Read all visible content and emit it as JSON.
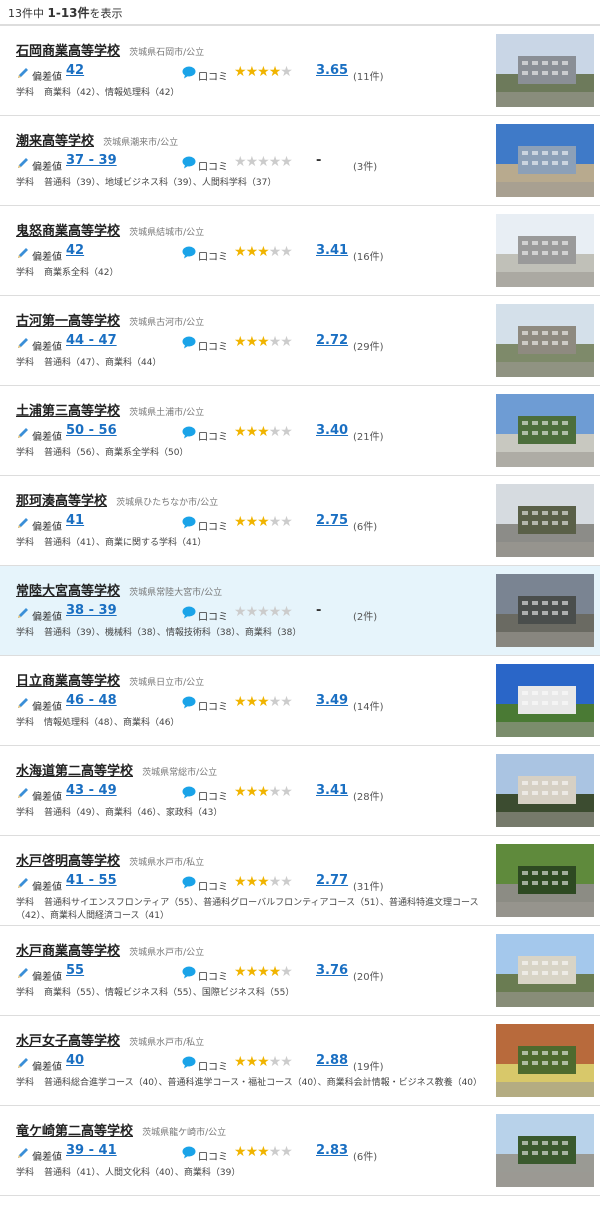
{
  "summary": {
    "prefix": "13件中",
    "range": "1-13件",
    "suffix": "を表示"
  },
  "labels": {
    "hensachi": "偏差値",
    "review": "口コミ",
    "dept": "学科"
  },
  "schools": [
    {
      "name": "石岡商業高等学校",
      "location": "茨城県石岡市/公立",
      "hensachi": "42",
      "stars": 4,
      "score": "3.65",
      "count": "(11件)",
      "departments": "商業科（42）、情報処理科（42）",
      "photo": [
        "#c9d6e6",
        "#8a8f96",
        "#6d7a5b"
      ]
    },
    {
      "name": "潮来高等学校",
      "location": "茨城県潮来市/公立",
      "hensachi": "37 - 39",
      "stars": 0,
      "score": "-",
      "count": "(3件)",
      "departments": "普通科（39）、地域ビジネス科（39）、人間科学科（37）",
      "photo": [
        "#3f7ac8",
        "#8ca0b8",
        "#b8aa8e"
      ]
    },
    {
      "name": "鬼怒商業高等学校",
      "location": "茨城県結城市/公立",
      "hensachi": "42",
      "stars": 3,
      "score": "3.41",
      "count": "(16件)",
      "departments": "商業系全科（42）",
      "photo": [
        "#e8eef4",
        "#9a9a9a",
        "#c0c0b8"
      ]
    },
    {
      "name": "古河第一高等学校",
      "location": "茨城県古河市/公立",
      "hensachi": "44 - 47",
      "stars": 3,
      "score": "2.72",
      "count": "(29件)",
      "departments": "普通科（47）、商業科（44）",
      "photo": [
        "#d4e0ea",
        "#8e8a80",
        "#7e8a6a"
      ]
    },
    {
      "name": "土浦第三高等学校",
      "location": "茨城県土浦市/公立",
      "hensachi": "50 - 56",
      "stars": 3,
      "score": "3.40",
      "count": "(21件)",
      "departments": "普通科（56）、商業系全学科（50）",
      "photo": [
        "#6e9cd4",
        "#4c6e3c",
        "#c8c8c0"
      ]
    },
    {
      "name": "那珂湊高等学校",
      "location": "茨城県ひたちなか市/公立",
      "hensachi": "41",
      "stars": 3,
      "score": "2.75",
      "count": "(6件)",
      "departments": "普通科（41）、商業に関する学科（41）",
      "photo": [
        "#d6dbe0",
        "#5a6048",
        "#8c8c88"
      ]
    },
    {
      "name": "常陸大宮高等学校",
      "location": "茨城県常陸大宮市/公立",
      "hensachi": "38 - 39",
      "stars": 0,
      "score": "-",
      "count": "(2件)",
      "departments": "普通科（39）、機械科（38）、情報技術科（38）、商業科（38）",
      "photo": [
        "#7a8492",
        "#4a4e4c",
        "#6a6a62"
      ]
    },
    {
      "name": "日立商業高等学校",
      "location": "茨城県日立市/公立",
      "hensachi": "46 - 48",
      "stars": 3,
      "score": "3.49",
      "count": "(14件)",
      "departments": "情報処理科（48）、商業科（46）",
      "photo": [
        "#2a66c8",
        "#e8e8e8",
        "#4a7a34"
      ]
    },
    {
      "name": "水海道第二高等学校",
      "location": "茨城県常総市/公立",
      "hensachi": "43 - 49",
      "stars": 3,
      "score": "3.41",
      "count": "(28件)",
      "departments": "普通科（49）、商業科（46）、家政科（43）",
      "photo": [
        "#aac4e2",
        "#d6d0c4",
        "#3c4c30"
      ]
    },
    {
      "name": "水戸啓明高等学校",
      "location": "茨城県水戸市/私立",
      "hensachi": "41 - 55",
      "stars": 3,
      "score": "2.77",
      "count": "(31件)",
      "departments": "普通科サイエンスフロンティア（55）、普通科グローバルフロンティアコース（51）、普通科特進文理コース（42）、商業科人間経済コース（41）",
      "photo": [
        "#5f8a3c",
        "#2e4a22",
        "#8c8c84"
      ]
    },
    {
      "name": "水戸商業高等学校",
      "location": "茨城県水戸市/公立",
      "hensachi": "55",
      "stars": 4,
      "score": "3.76",
      "count": "(20件)",
      "departments": "商業科（55）、情報ビジネス科（55）、国際ビジネス科（55）",
      "photo": [
        "#a4c8ec",
        "#d8d4c6",
        "#6a7c52"
      ]
    },
    {
      "name": "水戸女子高等学校",
      "location": "茨城県水戸市/私立",
      "hensachi": "40",
      "stars": 3,
      "score": "2.88",
      "count": "(19件)",
      "departments": "普通科総合進学コース（40）、普通科進学コース・福祉コース（40）、商業科会計情報・ビジネス教養（40）",
      "photo": [
        "#b86a3c",
        "#4e6a2e",
        "#d8c86a"
      ]
    },
    {
      "name": "竜ケ崎第二高等学校",
      "location": "茨城県龍ケ崎市/公立",
      "hensachi": "39 - 41",
      "stars": 3,
      "score": "2.83",
      "count": "(6件)",
      "departments": "普通科（41）、人間文化科（40）、商業科（39）",
      "photo": [
        "#b8d2ea",
        "#3a5a2e",
        "#9a9a94"
      ]
    }
  ]
}
